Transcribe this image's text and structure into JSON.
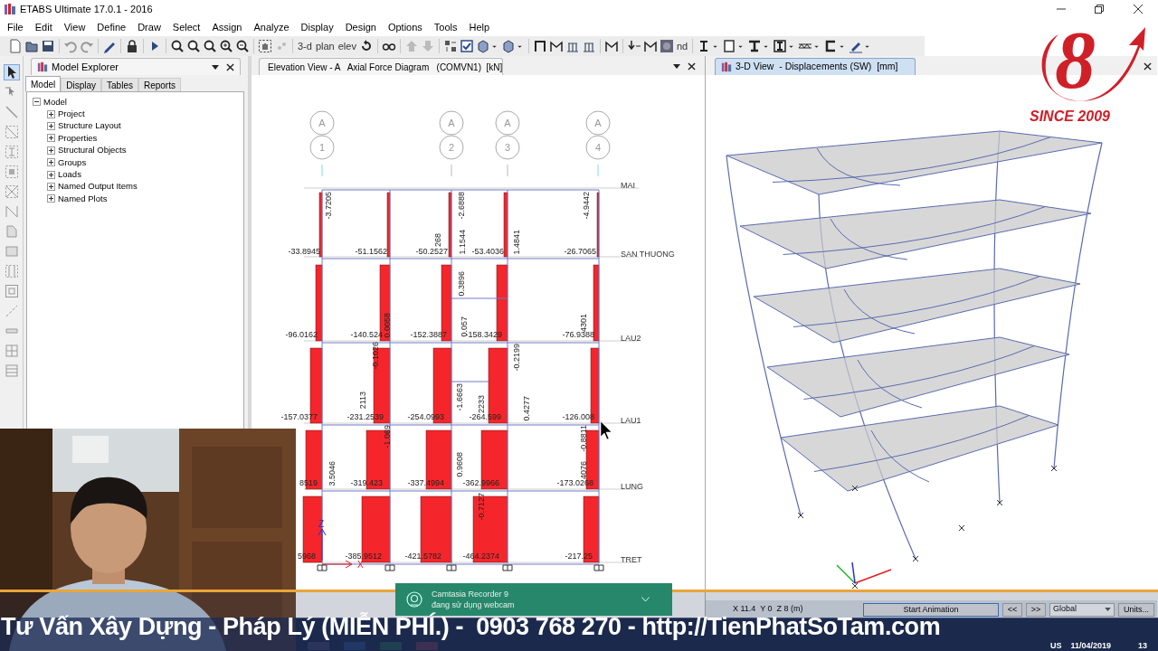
{
  "window": {
    "title": "ETABS Ultimate 17.0.1 - 2016"
  },
  "menu": [
    "File",
    "Edit",
    "View",
    "Define",
    "Draw",
    "Select",
    "Assign",
    "Analyze",
    "Display",
    "Design",
    "Options",
    "Tools",
    "Help"
  ],
  "toolbar_labels": [
    "3-d",
    "plan",
    "elev",
    "nd"
  ],
  "model_explorer": {
    "title": "Model Explorer",
    "tabs": [
      {
        "label": "Model",
        "selected": true
      },
      {
        "label": "Display",
        "selected": false
      },
      {
        "label": "Tables",
        "selected": false
      },
      {
        "label": "Reports",
        "selected": false
      }
    ],
    "tree": [
      {
        "label": "Model",
        "expanded": true,
        "children": [
          {
            "label": "Project",
            "expanded": false
          },
          {
            "label": "Structure Layout",
            "expanded": false
          },
          {
            "label": "Properties",
            "expanded": false
          },
          {
            "label": "Structural Objects",
            "expanded": false
          },
          {
            "label": "Groups",
            "expanded": false
          },
          {
            "label": "Loads",
            "expanded": false
          },
          {
            "label": "Named Output Items",
            "expanded": false
          },
          {
            "label": "Named Plots",
            "expanded": false
          }
        ]
      }
    ]
  },
  "elevation_view": {
    "tab": {
      "title": "Elevation View - A   Axial Force Diagram   (COMVN1)  [kN]",
      "selected": false
    },
    "grid_bubbles": [
      {
        "row": "A",
        "column": "1"
      },
      {
        "row": "A",
        "column": "2"
      },
      {
        "row": "A",
        "column": "3"
      },
      {
        "row": "A",
        "column": "4"
      }
    ],
    "stories": [
      "MAI",
      "SAN THUONG",
      "LAU2",
      "LAU1",
      "LUNG",
      "TRET"
    ],
    "value_labels": [
      "-3.7205",
      "-2.6888",
      "-4.9442",
      "268",
      "1.1544",
      "1.4841",
      "-33.8945",
      "-51.1562",
      "-50.2527",
      "-53.4036",
      "-26.7065",
      "0.3896",
      "0.057",
      "0.0058",
      "4301",
      "-96.0162",
      "-140.524",
      "-152.3887",
      "-158.3429",
      "-76.9388",
      "-0.1026",
      "-0.2199",
      "-1.6663",
      "2233",
      "0.4277",
      "2113",
      "-157.0377",
      "-231.2539",
      "-254.0993",
      "-264.599",
      "-126.008",
      "-1.069",
      "-0.8811",
      "3.5046",
      "0.9608",
      "4076",
      "8519",
      "-319.423",
      "-337.4994",
      "-362.9966",
      "-173.0268",
      "-0.7127",
      "5968",
      "-385.9512",
      "-421.5782",
      "-464.2374",
      "-217.25"
    ],
    "axis_labels": [
      "Z",
      "X"
    ]
  },
  "view_3d": {
    "tab": {
      "title": "3-D View  - Displacements (SW)  [mm]",
      "selected": true
    },
    "coordinates": "X 11.4  Y 0  Z 8 (m)",
    "animation_button": "Start Animation",
    "step_buttons": [
      "<<",
      ">>"
    ],
    "coordinate_system": "Global",
    "units_button": "Units..."
  },
  "logo": {
    "mark": "8",
    "tagline": "SINCE 2009"
  },
  "notification": {
    "title": "Camtasia Recorder 9",
    "message": "đang sử dụng webcam"
  },
  "banner": {
    "text": "Tư Vấn Xây Dựng - Pháp Lý (MIỄN PHÍ.) -  0903 768 270 - http://TienPhatSoTam.com"
  },
  "taskbar": {
    "language": "US",
    "date": "11/04/2019",
    "badge": "13"
  }
}
